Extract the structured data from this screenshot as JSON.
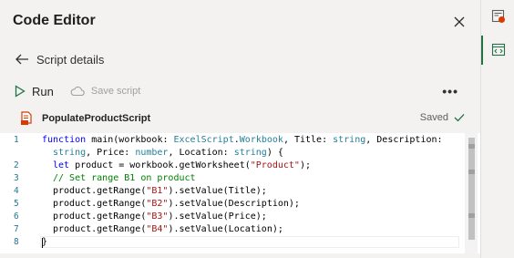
{
  "pane": {
    "title": "Code Editor",
    "back_label": "Script details",
    "run_label": "Run",
    "save_label": "Save script",
    "more_label": "•••",
    "file_name": "PopulateProductScript",
    "saved_label": "Saved"
  },
  "editor": {
    "line_numbers": [
      "1",
      "2",
      "3",
      "4",
      "5",
      "6",
      "7",
      "8"
    ]
  },
  "colors": {
    "accent": "#217346",
    "icon_orange": "#d83b01"
  }
}
